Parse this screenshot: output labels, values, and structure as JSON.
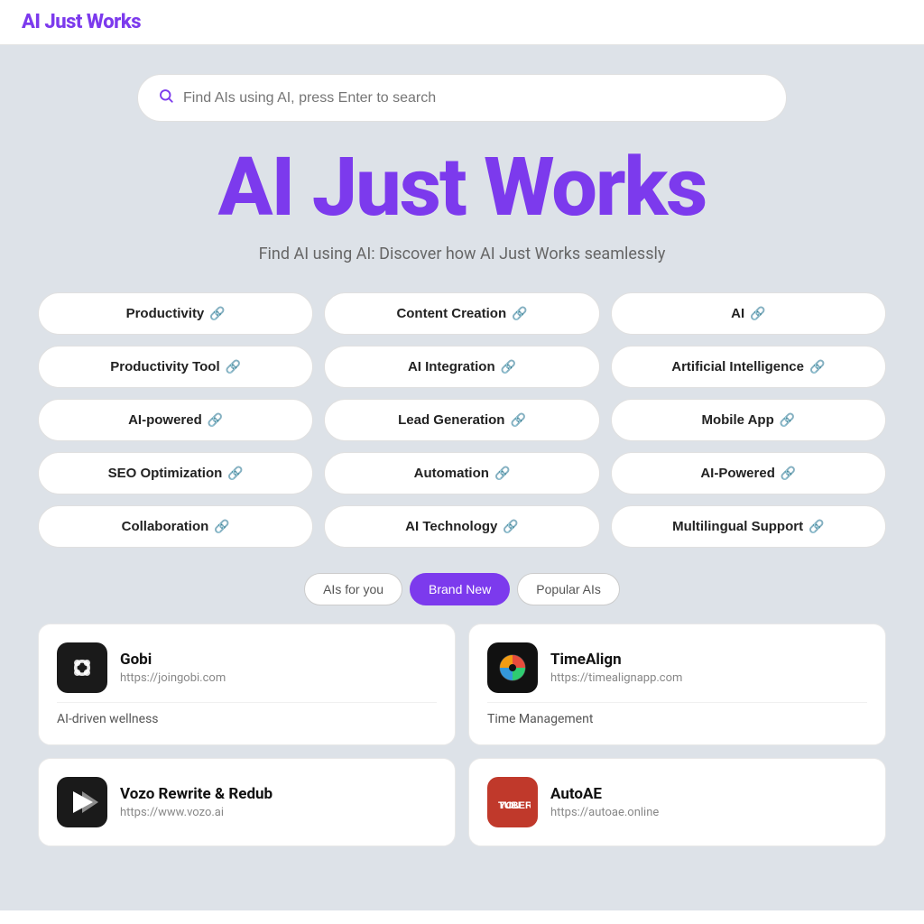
{
  "header": {
    "logo": "AI Just Works"
  },
  "search": {
    "placeholder": "Find AIs using AI, press Enter to search"
  },
  "hero": {
    "title": "AI Just Works",
    "subtitle": "Find AI using AI: Discover how AI Just Works seamlessly"
  },
  "tags": [
    {
      "label": "Productivity",
      "col": 1
    },
    {
      "label": "Content Creation",
      "col": 2
    },
    {
      "label": "AI",
      "col": 3
    },
    {
      "label": "Productivity Tool",
      "col": 1
    },
    {
      "label": "AI Integration",
      "col": 2
    },
    {
      "label": "Artificial Intelligence",
      "col": 3
    },
    {
      "label": "AI-powered",
      "col": 1
    },
    {
      "label": "Lead Generation",
      "col": 2
    },
    {
      "label": "Mobile App",
      "col": 3
    },
    {
      "label": "SEO Optimization",
      "col": 1
    },
    {
      "label": "Automation",
      "col": 2
    },
    {
      "label": "AI-Powered",
      "col": 3
    },
    {
      "label": "Collaboration",
      "col": 1
    },
    {
      "label": "AI Technology",
      "col": 2
    },
    {
      "label": "Multilingual Support",
      "col": 3
    }
  ],
  "filter_tabs": [
    {
      "label": "AIs for you",
      "active": false
    },
    {
      "label": "Brand New",
      "active": true
    },
    {
      "label": "Popular AIs",
      "active": false
    }
  ],
  "ai_cards": [
    {
      "name": "Gobi",
      "url": "https://joingobi.com",
      "description": "AI-driven wellness",
      "logo_type": "gobi"
    },
    {
      "name": "TimeAlign",
      "url": "https://timealignapp.com",
      "description": "Time Management",
      "logo_type": "timealign"
    },
    {
      "name": "Vozo Rewrite & Redub",
      "url": "https://www.vozo.ai",
      "description": "",
      "logo_type": "vozo"
    },
    {
      "name": "AutoAE",
      "url": "https://autoae.online",
      "description": "",
      "logo_type": "autoae"
    }
  ]
}
